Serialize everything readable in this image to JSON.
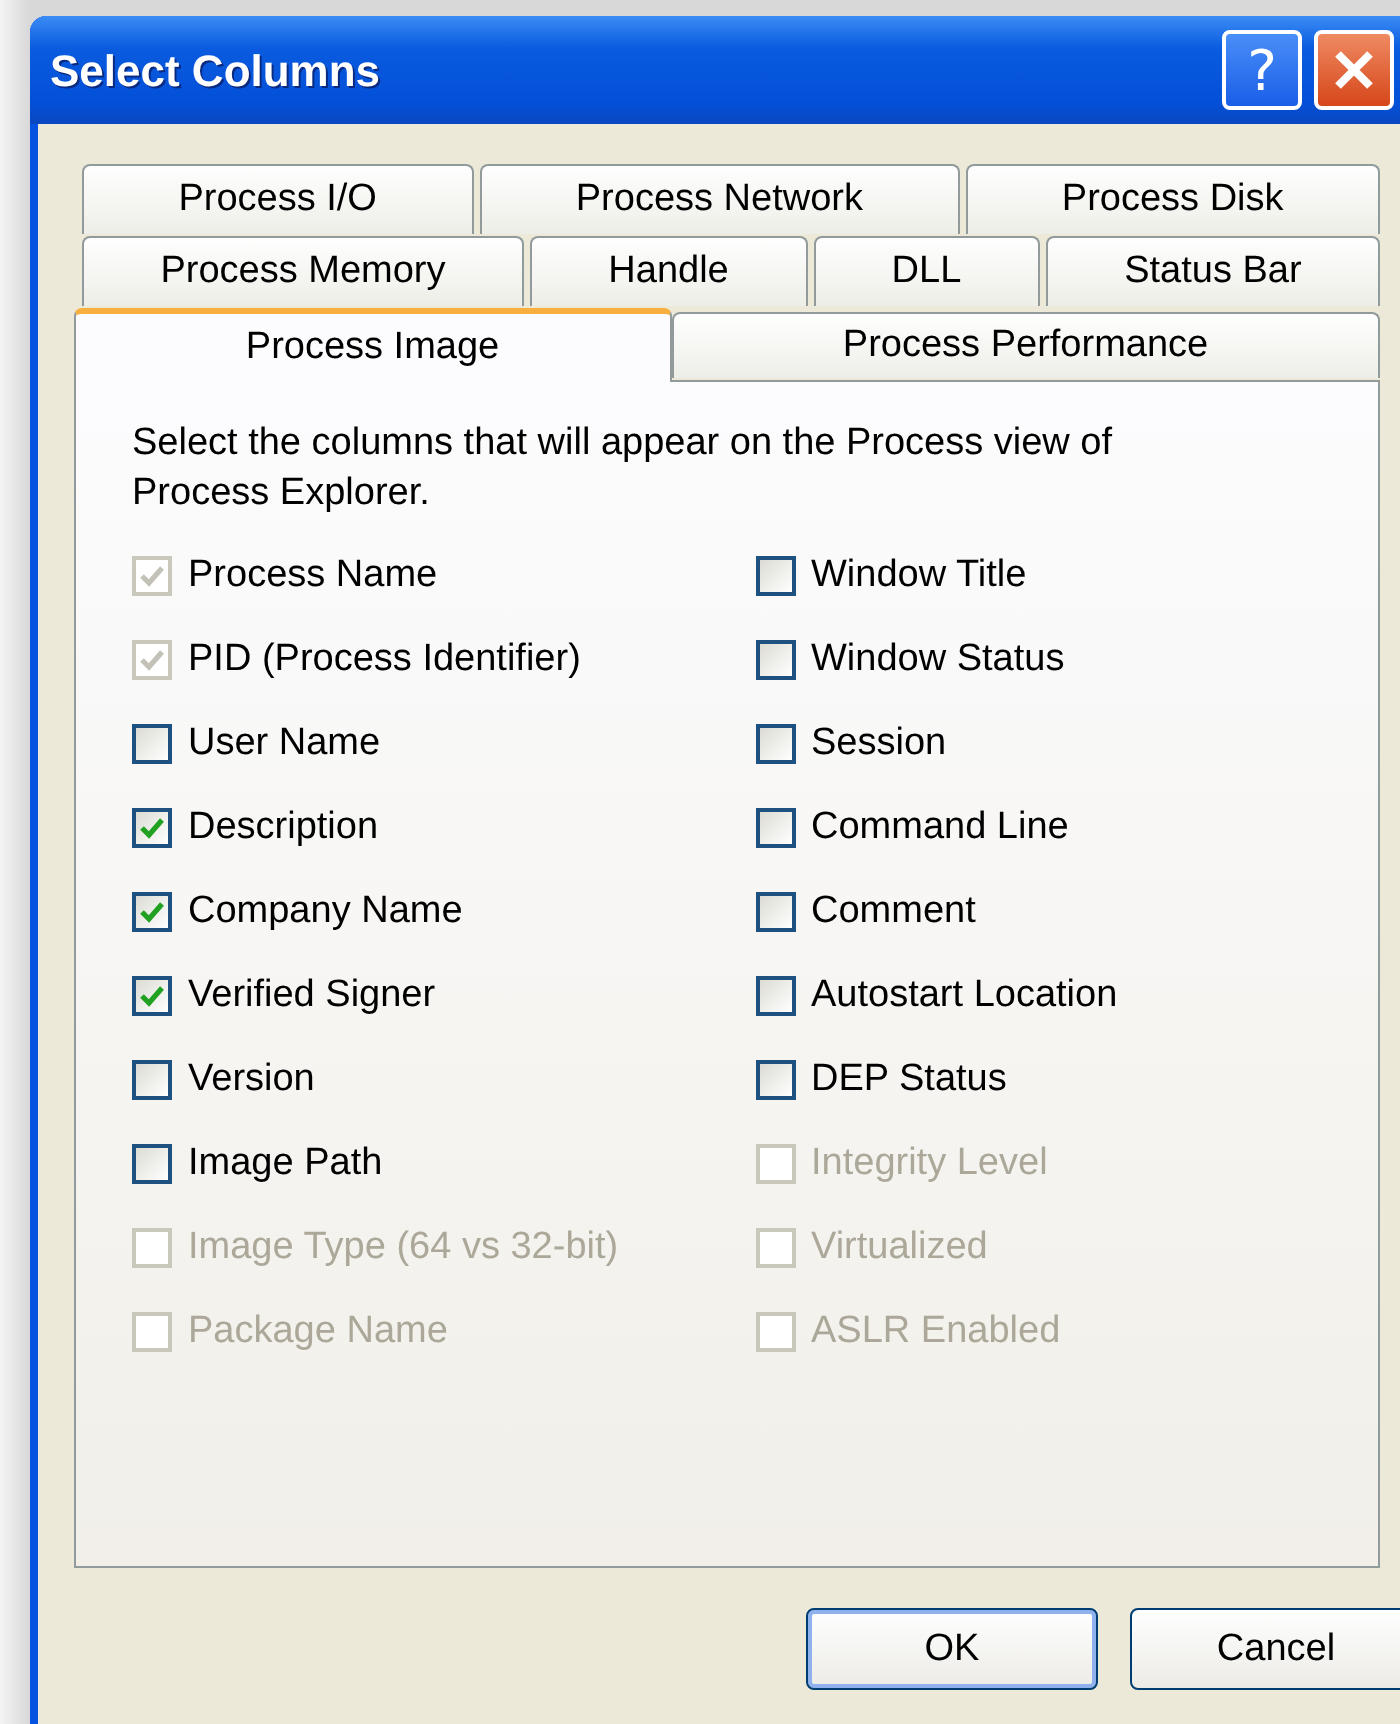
{
  "window": {
    "title": "Select Columns",
    "title_buttons": [
      {
        "kind": "help",
        "label": "?"
      },
      {
        "kind": "close"
      }
    ]
  },
  "tab_rows": [
    [
      {
        "label": "Process I/O",
        "selected": false
      },
      {
        "label": "Process Network",
        "selected": false
      },
      {
        "label": "Process Disk",
        "selected": false
      }
    ],
    [
      {
        "label": "Process Memory",
        "selected": false
      },
      {
        "label": "Handle",
        "selected": false
      },
      {
        "label": "DLL",
        "selected": false
      },
      {
        "label": "Status Bar",
        "selected": false
      }
    ],
    [
      {
        "label": "Process Image",
        "selected": true
      },
      {
        "label": "Process Performance",
        "selected": false
      }
    ]
  ],
  "description": "Select the columns that will appear on the Process view of Process Explorer.",
  "columns": [
    [
      {
        "label": "Process Name",
        "checked": true,
        "disabled": true
      },
      {
        "label": "PID (Process Identifier)",
        "checked": true,
        "disabled": true
      },
      {
        "label": "User Name",
        "checked": false,
        "disabled": false
      },
      {
        "label": "Description",
        "checked": true,
        "disabled": false
      },
      {
        "label": "Company Name",
        "checked": true,
        "disabled": false
      },
      {
        "label": "Verified Signer",
        "checked": true,
        "disabled": false
      },
      {
        "label": "Version",
        "checked": false,
        "disabled": false
      },
      {
        "label": "Image Path",
        "checked": false,
        "disabled": false
      },
      {
        "label": "Image Type (64 vs 32-bit)",
        "checked": false,
        "disabled": true
      },
      {
        "label": "Package Name",
        "checked": false,
        "disabled": true
      }
    ],
    [
      {
        "label": "Window Title",
        "checked": false,
        "disabled": false
      },
      {
        "label": "Window Status",
        "checked": false,
        "disabled": false
      },
      {
        "label": "Session",
        "checked": false,
        "disabled": false
      },
      {
        "label": "Command Line",
        "checked": false,
        "disabled": false
      },
      {
        "label": "Comment",
        "checked": false,
        "disabled": false
      },
      {
        "label": "Autostart Location",
        "checked": false,
        "disabled": false
      },
      {
        "label": "DEP Status",
        "checked": false,
        "disabled": false
      },
      {
        "label": "Integrity Level",
        "checked": false,
        "disabled": true
      },
      {
        "label": "Virtualized",
        "checked": false,
        "disabled": true
      },
      {
        "label": "ASLR Enabled",
        "checked": false,
        "disabled": true
      }
    ]
  ],
  "buttons": [
    {
      "label": "OK",
      "default": true
    },
    {
      "label": "Cancel",
      "default": false
    }
  ]
}
